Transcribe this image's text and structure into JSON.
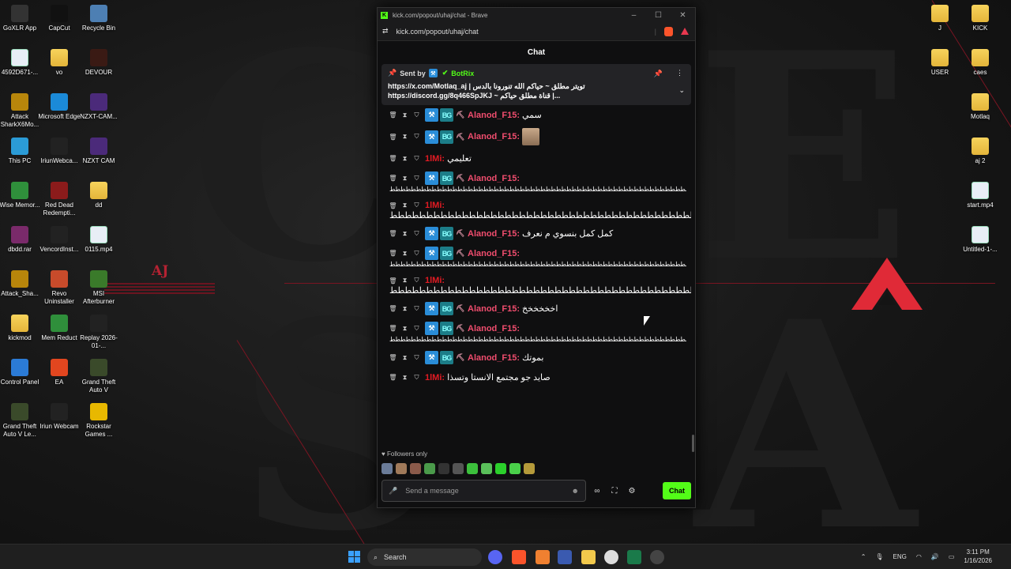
{
  "window": {
    "title": "kick.com/popout/uhaj/chat - Brave",
    "url": "kick.com/popout/uhaj/chat",
    "header": "Chat"
  },
  "pinned": {
    "sent_by": "Sent by",
    "bot": "BotRix",
    "line1": "https://x.com/Motlaq_aj | تويتر مطلق ~ حياكم الله تنورونا بالدس",
    "line2": "https://discord.gg/8q466SpJKJ ~ قناة مطلق حياكم |..."
  },
  "messages": [
    {
      "user": "Alanod_F15",
      "kind": "alanod",
      "text": "سمي",
      "wrap": ""
    },
    {
      "user": "Alanod_F15",
      "kind": "alanod",
      "text": "",
      "wrap": "",
      "emote": true
    },
    {
      "user": "1lMi",
      "kind": "ilmi",
      "text": "تعليمي",
      "wrap": ""
    },
    {
      "user": "Alanod_F15",
      "kind": "alanod",
      "text": "",
      "wrap": "ططططططططططططططططططططططططططططططططططططططططططططططططططططططططططططططططططططططططططططططططططططططط"
    },
    {
      "user": "1lMi",
      "kind": "ilmi",
      "text": "ططططططططططططططططططططططططططططططططططططططططططططططط",
      "wrap": ""
    },
    {
      "user": "Alanod_F15",
      "kind": "alanod",
      "text": "كمل كمل بنسوي م نعرف",
      "wrap": ""
    },
    {
      "user": "Alanod_F15",
      "kind": "alanod",
      "text": "",
      "wrap": "ططططططططططططططططططططططططططططططططططططططططططططططططططططططططططططططططططططططططططططططططططططططط"
    },
    {
      "user": "1lMi",
      "kind": "ilmi",
      "text": "ططططططططططططططططططططططططططططططططططططططططططططططط",
      "wrap": ""
    },
    {
      "user": "Alanod_F15",
      "kind": "alanod",
      "text": "اخخخخخخ",
      "wrap": ""
    },
    {
      "user": "Alanod_F15",
      "kind": "alanod",
      "text": "",
      "wrap": "ططططططططططططططططططططططططططططططططططططططططططططططططططططططططططططططططططططططططططططططططططططططط"
    },
    {
      "user": "Alanod_F15",
      "kind": "alanod",
      "text": "بموتك",
      "wrap": ""
    },
    {
      "user": "1lMi",
      "kind": "ilmi",
      "text": "صايد جو مجتمع الانستا وتسذا",
      "wrap": ""
    }
  ],
  "followers_only": "Followers only",
  "input": {
    "placeholder": "Send a message",
    "send_label": "Chat"
  },
  "desktop_left": [
    {
      "label": "GoXLR App",
      "color": "#333"
    },
    {
      "label": "CapCut",
      "color": "#111"
    },
    {
      "label": "Recycle Bin",
      "color": "#4d7fb3"
    },
    {
      "label": "4592D671-...",
      "color": "file"
    },
    {
      "label": "vo",
      "color": "folder"
    },
    {
      "label": "DEVOUR",
      "color": "#3a1a14"
    },
    {
      "label": "Attack SharkX6Mo...",
      "color": "#b8860b"
    },
    {
      "label": "Microsoft Edge",
      "color": "#1b8ad8"
    },
    {
      "label": "NZXT-CAM...",
      "color": "#4b2a7a"
    },
    {
      "label": "This PC",
      "color": "#2b9bd6"
    },
    {
      "label": "IriunWebca...",
      "color": "#222"
    },
    {
      "label": "NZXT CAM",
      "color": "#4b2a7a"
    },
    {
      "label": "Wise Memor...",
      "color": "#2f8f3b"
    },
    {
      "label": "Red Dead Redempti...",
      "color": "#8b1b1b"
    },
    {
      "label": "dd",
      "color": "folder"
    },
    {
      "label": "dbdd.rar",
      "color": "#7a2a6a"
    },
    {
      "label": "VencordInst...",
      "color": "#222"
    },
    {
      "label": "0115.mp4",
      "color": "file"
    },
    {
      "label": "Attack_Sha...",
      "color": "#b8860b"
    },
    {
      "label": "Revo Uninstaller",
      "color": "#c84b2b"
    },
    {
      "label": "MSI Afterburner",
      "color": "#3a7a2a"
    },
    {
      "label": "kickmod",
      "color": "folder"
    },
    {
      "label": "Mem Reduct",
      "color": "#2f8f3b"
    },
    {
      "label": "Replay 2026-01-...",
      "color": "#222"
    },
    {
      "label": "Control Panel",
      "color": "#2b7bd6"
    },
    {
      "label": "EA",
      "color": "#e2461f"
    },
    {
      "label": "Grand Theft Auto V",
      "color": "#3a4a2a"
    },
    {
      "label": "Grand Theft Auto V Le...",
      "color": "#3a4a2a"
    },
    {
      "label": "Iriun Webcam",
      "color": "#222"
    },
    {
      "label": "Rockstar Games ...",
      "color": "#e8b800"
    }
  ],
  "desktop_right": [
    {
      "label": "J",
      "color": "folder"
    },
    {
      "label": "KICK",
      "color": "folder"
    },
    {
      "label": "USER",
      "color": "folder"
    },
    {
      "label": "caes",
      "color": "folder"
    },
    {
      "label": "Motlaq",
      "color": "folder"
    },
    {
      "label": "aj 2",
      "color": "folder"
    },
    {
      "label": "start.mp4",
      "color": "file"
    },
    {
      "label": "Untitled-1-...",
      "color": "file"
    }
  ],
  "wallpaper": {
    "logo": "AJ"
  },
  "taskbar": {
    "search": "Search",
    "lang": "ENG",
    "time": "3:11 PM",
    "date": "1/16/2026"
  }
}
